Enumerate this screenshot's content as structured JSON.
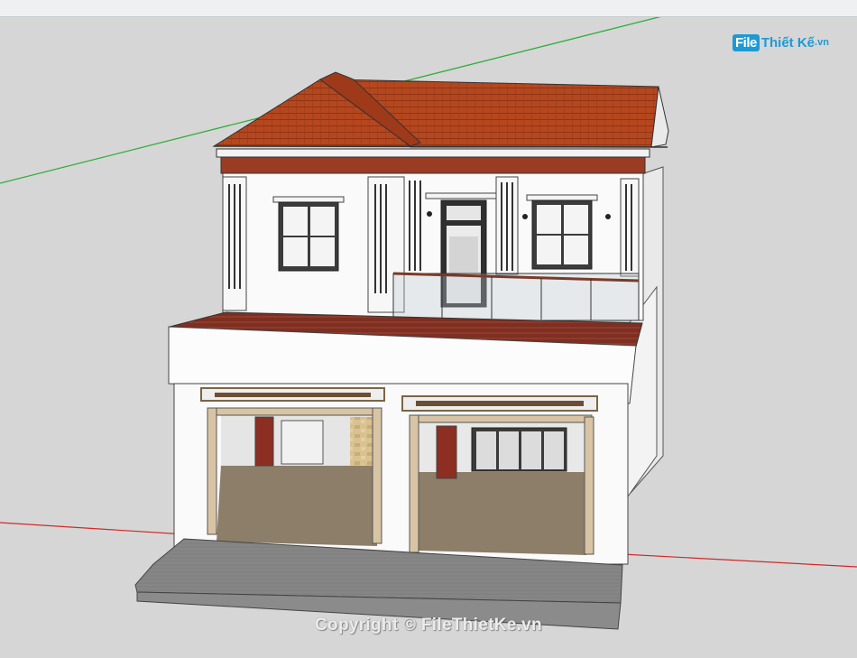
{
  "logo": {
    "badge": "File",
    "brand": "Thiết Kế",
    "suffix": ".vn"
  },
  "watermark": {
    "text": "Copyright © FileThietKe.vn"
  },
  "colors": {
    "roof": "#b5471f",
    "wall": "#fafafa",
    "trim": "#d8c4a4",
    "axis_green": "#2fae3a",
    "axis_red": "#d02a2a",
    "floor": "#8f7f6a",
    "background": "#d6d6d6",
    "brand": "#1d9ad6"
  }
}
